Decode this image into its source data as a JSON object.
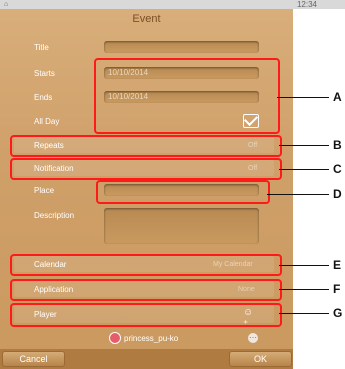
{
  "status": {
    "time": "12:34"
  },
  "header": {
    "title": "Event"
  },
  "form": {
    "title_label": "Title",
    "starts_label": "Starts",
    "starts_value": "10/10/2014",
    "ends_label": "Ends",
    "ends_value": "10/10/2014",
    "allday_label": "All Day",
    "repeats_label": "Repeats",
    "repeats_value": "Off",
    "notification_label": "Notification",
    "notification_value": "Off",
    "place_label": "Place",
    "description_label": "Description",
    "calendar_label": "Calendar",
    "calendar_value": "My Calendar",
    "application_label": "Application",
    "application_value": "None",
    "player_label": "Player"
  },
  "user": {
    "name": "princess_pu-ko"
  },
  "buttons": {
    "cancel": "Cancel",
    "ok": "OK"
  },
  "callouts": [
    "A",
    "B",
    "C",
    "D",
    "E",
    "F",
    "G"
  ],
  "colors": {
    "panel": "#d0a06a",
    "highlight": "#ff1a1a"
  }
}
